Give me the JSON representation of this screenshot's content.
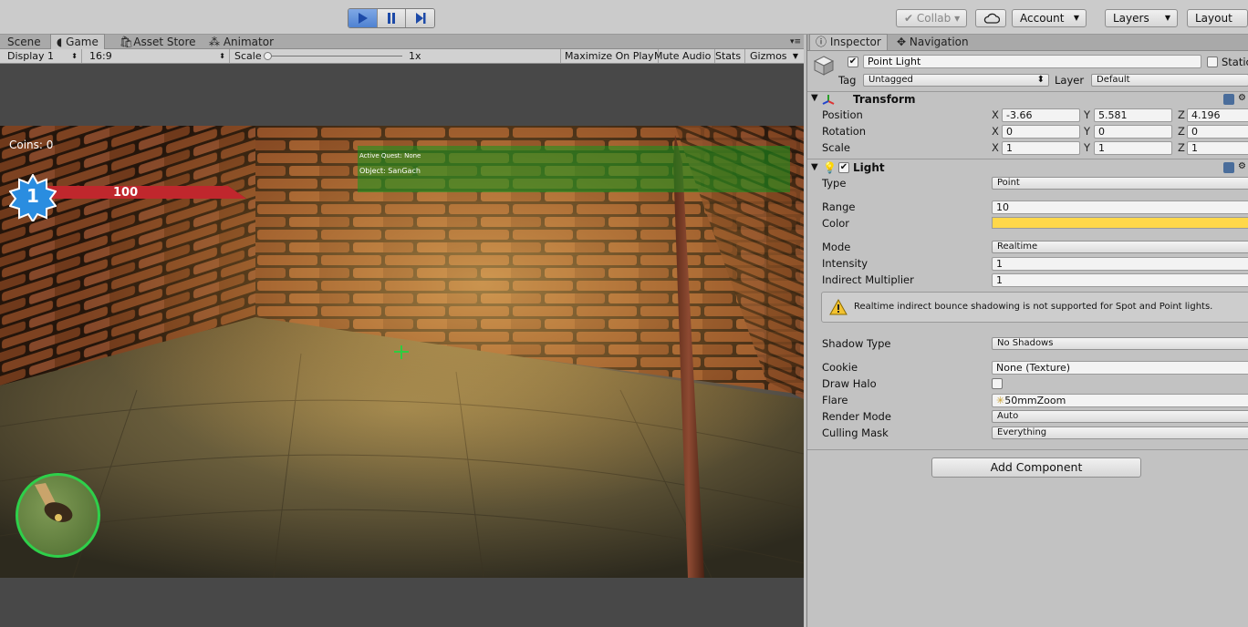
{
  "toolbar": {
    "collab": "Collab ▾",
    "account": "Account",
    "layers": "Layers",
    "layout": "Layout"
  },
  "tabs": {
    "scene": "Scene",
    "game": "Game",
    "asset_store": "Asset Store",
    "animator": "Animator"
  },
  "gamebar": {
    "display": "Display 1",
    "aspect": "16:9",
    "scale_label": "Scale",
    "scale_value": "1x",
    "maximize": "Maximize On Play",
    "mute": "Mute Audio",
    "stats": "Stats",
    "gizmos": "Gizmos"
  },
  "hud": {
    "coins": "Coins: 0",
    "level": "1",
    "health": "100",
    "quest_line1": "Active Quest: None",
    "quest_line2": "Object: SanGach",
    "health_fraction": 1.0
  },
  "inspector": {
    "tab_inspector": "Inspector",
    "tab_navigation": "Navigation",
    "object_name": "Point Light",
    "static_label": "Static",
    "tag_label": "Tag",
    "tag_value": "Untagged",
    "layer_label": "Layer",
    "layer_value": "Default",
    "transform": {
      "title": "Transform",
      "position_label": "Position",
      "rotation_label": "Rotation",
      "scale_label": "Scale",
      "pos_x": "-3.66",
      "pos_y": "5.581",
      "pos_z": "4.196",
      "rot_x": "0",
      "rot_y": "0",
      "rot_z": "0",
      "scl_x": "1",
      "scl_y": "1",
      "scl_z": "1",
      "x": "X",
      "y": "Y",
      "z": "Z"
    },
    "light": {
      "title": "Light",
      "type_label": "Type",
      "type_value": "Point",
      "range_label": "Range",
      "range_value": "10",
      "color_label": "Color",
      "color_value": "#ffd84a",
      "mode_label": "Mode",
      "mode_value": "Realtime",
      "intensity_label": "Intensity",
      "intensity_value": "1",
      "indirect_label": "Indirect Multiplier",
      "indirect_value": "1",
      "warning": "Realtime indirect bounce shadowing is not supported for Spot and Point lights.",
      "shadow_label": "Shadow Type",
      "shadow_value": "No Shadows",
      "cookie_label": "Cookie",
      "cookie_value": "None (Texture)",
      "halo_label": "Draw Halo",
      "flare_label": "Flare",
      "flare_value": "50mmZoom",
      "render_label": "Render Mode",
      "render_value": "Auto",
      "culling_label": "Culling Mask",
      "culling_value": "Everything"
    },
    "add_component": "Add Component"
  }
}
